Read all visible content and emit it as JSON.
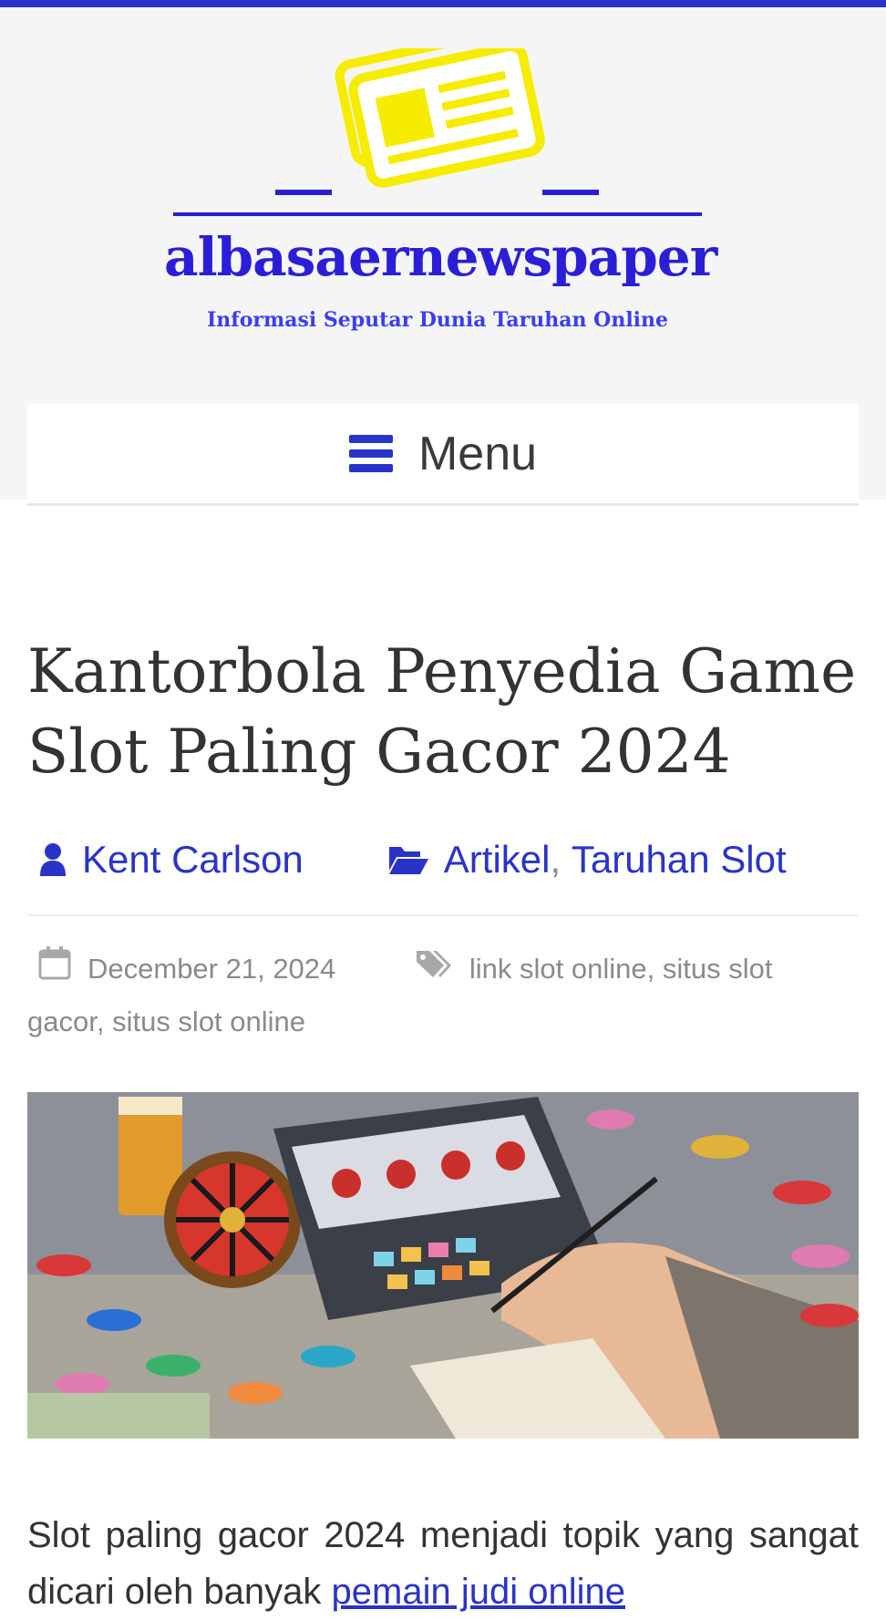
{
  "site": {
    "name": "albasaernewspaper",
    "tagline": "Informasi Seputar Dunia Taruhan Online"
  },
  "nav": {
    "menu_label": "Menu"
  },
  "post": {
    "title": "Kantorbola Penyedia Game Slot Paling Gacor 2024",
    "author": "Kent Carlson",
    "categories": [
      "Artikel",
      "Taruhan Slot"
    ],
    "date": "December 21, 2024",
    "tags": [
      "link slot online",
      "situs slot gacor",
      "situs slot online"
    ],
    "lead_text": "Slot paling gacor 2024 menjadi topik yang sangat dicari oleh banyak",
    "lead_link": "pemain judi online"
  },
  "icons": {
    "menu": "hamburger-icon",
    "author": "user-icon",
    "categories": "folder-open-icon",
    "date": "calendar-icon",
    "tags": "tags-icon"
  },
  "colors": {
    "accent": "#2a33c8",
    "logo_icon": "#f5ec00",
    "header_bg": "#f5f5f5"
  }
}
